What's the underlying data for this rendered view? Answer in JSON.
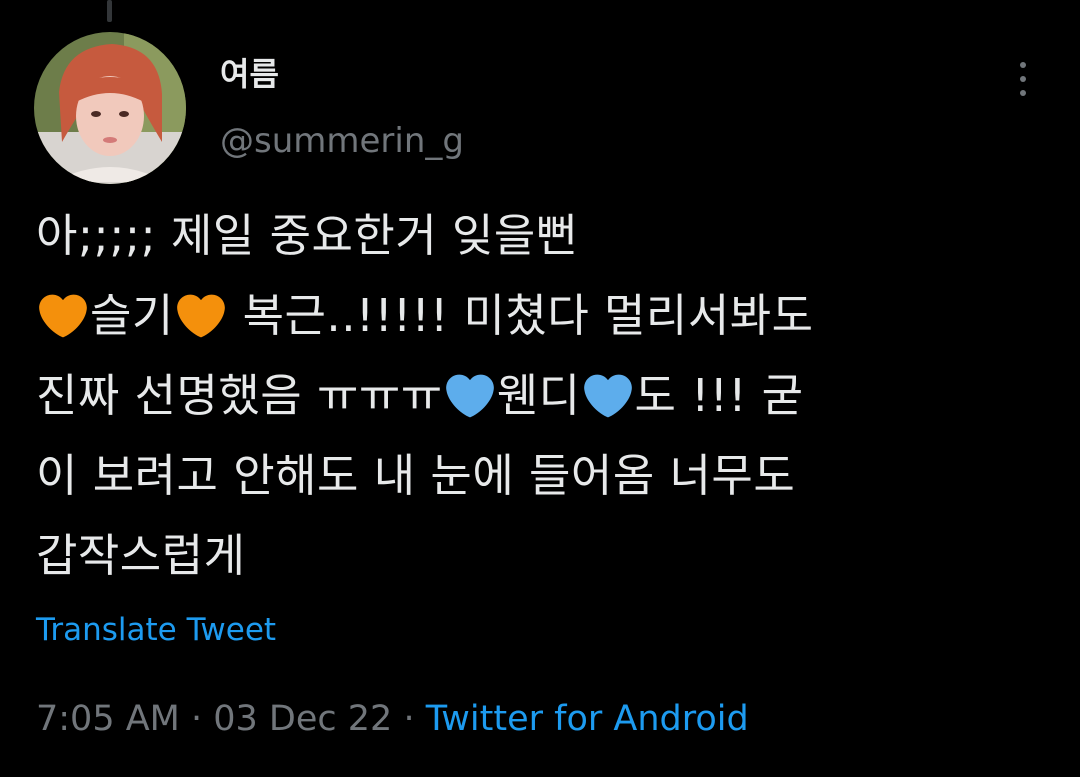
{
  "author": {
    "display_name": "여름",
    "handle": "@summerin_g"
  },
  "menu": {
    "more_icon": "more-vertical-icon"
  },
  "tweet": {
    "lines": [
      [
        "아;;;;; 제일 중요한거 잊을뻔"
      ],
      [
        "",
        "슬기",
        " 복근..!!!!! 미쳤다 멀리서봐도"
      ],
      [
        "진짜 선명했음 ㅠㅠㅠ",
        "웬디",
        "도 !!! 굳"
      ],
      [
        "이 보려고 안해도 내 눈에 들어옴 너무도"
      ],
      [
        "갑작스럽게"
      ]
    ],
    "emoji": {
      "orange_heart": "#f4900c",
      "blue_heart": "#5dadec"
    }
  },
  "translate_label": "Translate Tweet",
  "meta": {
    "time": "7:05 AM",
    "separator": " · ",
    "date": "03 Dec 22",
    "source": "Twitter for Android"
  },
  "colors": {
    "background": "#000000",
    "text": "#e7e9ea",
    "secondary": "#71767b",
    "link": "#1d9bf0"
  }
}
